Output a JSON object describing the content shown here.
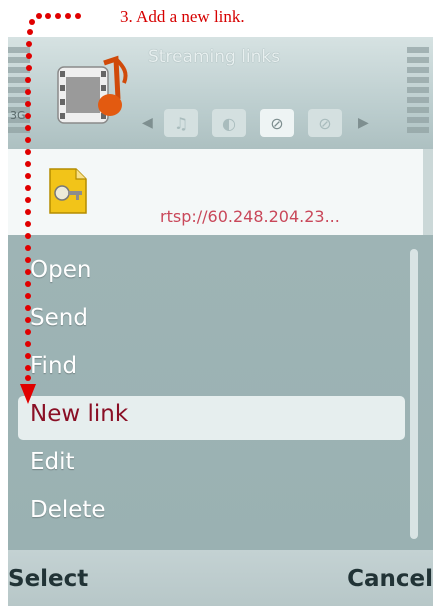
{
  "annotation": {
    "caption": "3. Add a new link."
  },
  "status": {
    "network": "3G"
  },
  "header": {
    "title": "Streaming links",
    "tabs": [
      {
        "icon": "music-note-icon",
        "glyph": "♫",
        "active": false
      },
      {
        "icon": "microphone-icon",
        "glyph": "●",
        "active": false
      },
      {
        "icon": "link-icon",
        "glyph": "⊘",
        "active": true
      },
      {
        "icon": "link-alt-icon",
        "glyph": "⊘",
        "active": false
      }
    ]
  },
  "link_item": {
    "url": "rtsp://60.248.204.23..."
  },
  "menu": {
    "items": [
      "Open",
      "Send",
      "Find",
      "New link",
      "Edit",
      "Delete"
    ],
    "selected": "New link"
  },
  "softkeys": {
    "left": "Select",
    "right": "Cancel"
  },
  "colors": {
    "annotation": "#e00000",
    "selected_text": "#8a0f25",
    "url_text": "#c9485a"
  }
}
